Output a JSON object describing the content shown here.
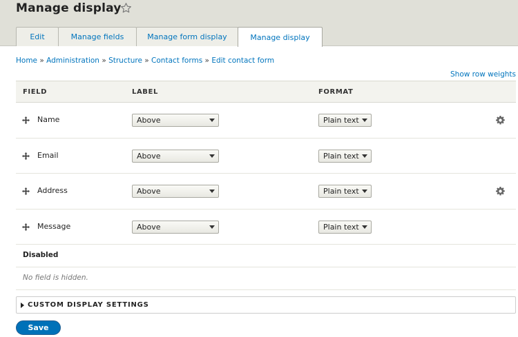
{
  "page": {
    "title": "Manage display",
    "star_icon": "star-outline-icon"
  },
  "tabs": [
    {
      "label": "Edit",
      "active": false
    },
    {
      "label": "Manage fields",
      "active": false
    },
    {
      "label": "Manage form display",
      "active": false
    },
    {
      "label": "Manage display",
      "active": true
    }
  ],
  "breadcrumb": {
    "items": [
      "Home",
      "Administration",
      "Structure",
      "Contact forms",
      "Edit contact form"
    ],
    "separator": "»"
  },
  "row_weights_link": "Show row weights",
  "table": {
    "headers": {
      "field": "FIELD",
      "label": "LABEL",
      "format": "FORMAT"
    },
    "rows": [
      {
        "field": "Name",
        "label": "Above",
        "format": "Plain text",
        "has_settings": true
      },
      {
        "field": "Email",
        "label": "Above",
        "format": "Plain text",
        "has_settings": false
      },
      {
        "field": "Address",
        "label": "Above",
        "format": "Plain text",
        "has_settings": true
      },
      {
        "field": "Message",
        "label": "Above",
        "format": "Plain text",
        "has_settings": false
      }
    ],
    "disabled_title": "Disabled",
    "hidden_message": "No field is hidden."
  },
  "custom_display": {
    "title": "CUSTOM DISPLAY SETTINGS"
  },
  "save_label": "Save",
  "colors": {
    "link": "#0074bd",
    "primary_button": "#0071b8",
    "header_bg": "#e0e0d8"
  }
}
